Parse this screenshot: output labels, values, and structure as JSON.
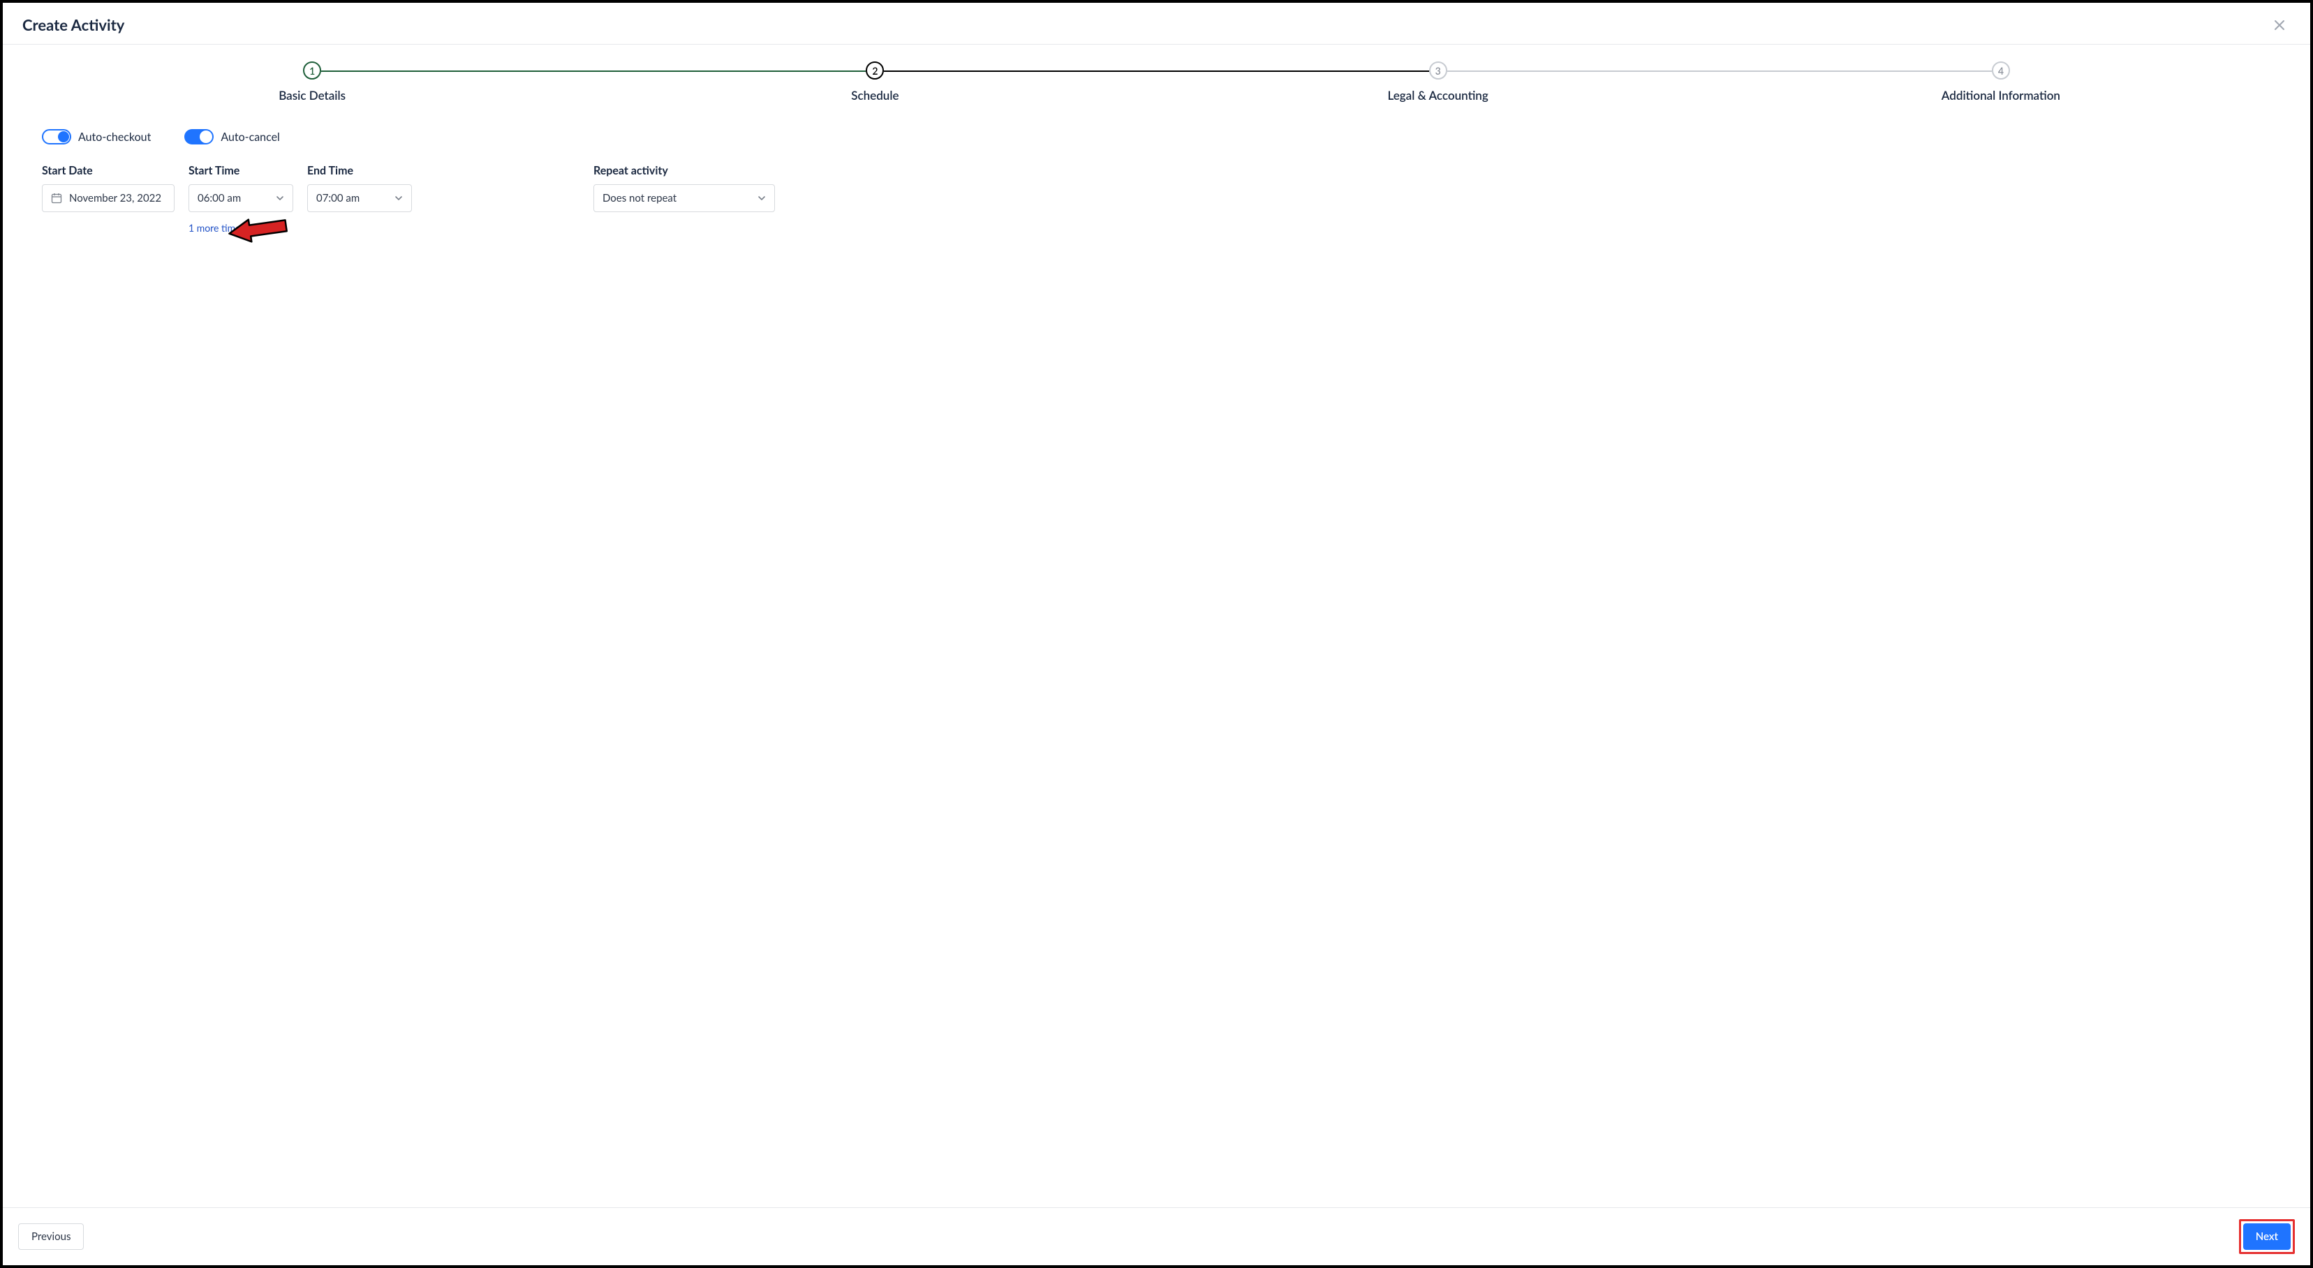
{
  "header": {
    "title": "Create Activity"
  },
  "stepper": {
    "steps": [
      {
        "num": "1",
        "label": "Basic Details"
      },
      {
        "num": "2",
        "label": "Schedule"
      },
      {
        "num": "3",
        "label": "Legal & Accounting"
      },
      {
        "num": "4",
        "label": "Additional Information"
      }
    ],
    "active_index": 1
  },
  "toggles": {
    "auto_checkout": {
      "label": "Auto-checkout",
      "on": true
    },
    "auto_cancel": {
      "label": "Auto-cancel",
      "on": true
    }
  },
  "fields": {
    "start_date": {
      "label": "Start Date",
      "value": "November 23, 2022"
    },
    "start_time": {
      "label": "Start Time",
      "value": "06:00 am"
    },
    "end_time": {
      "label": "End Time",
      "value": "07:00 am"
    },
    "more_link": "1 more time slots",
    "repeat": {
      "label": "Repeat activity",
      "value": "Does not repeat"
    }
  },
  "footer": {
    "previous": "Previous",
    "next": "Next"
  },
  "colors": {
    "primary": "#1f74ff",
    "step_done": "#1f5f3a",
    "annotation_red": "#d62323"
  }
}
